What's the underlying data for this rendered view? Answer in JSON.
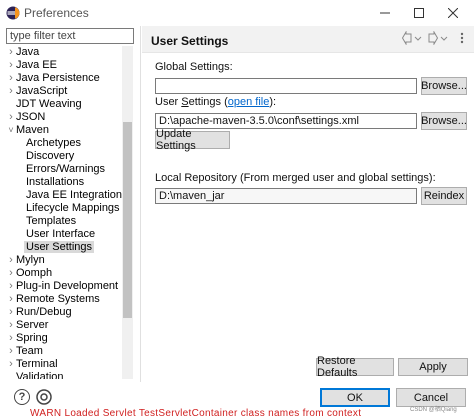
{
  "window": {
    "title": "Preferences"
  },
  "filter": {
    "placeholder": "type filter text"
  },
  "tree": {
    "items": [
      {
        "label": "Java",
        "expandable": true,
        "level": 0
      },
      {
        "label": "Java EE",
        "expandable": true,
        "level": 0
      },
      {
        "label": "Java Persistence",
        "expandable": true,
        "level": 0
      },
      {
        "label": "JavaScript",
        "expandable": true,
        "level": 0
      },
      {
        "label": "JDT Weaving",
        "expandable": false,
        "level": 0
      },
      {
        "label": "JSON",
        "expandable": true,
        "level": 0
      },
      {
        "label": "Maven",
        "expandable": true,
        "expanded": true,
        "level": 0
      },
      {
        "label": "Archetypes",
        "expandable": false,
        "level": 1
      },
      {
        "label": "Discovery",
        "expandable": false,
        "level": 1
      },
      {
        "label": "Errors/Warnings",
        "expandable": false,
        "level": 1
      },
      {
        "label": "Installations",
        "expandable": false,
        "level": 1
      },
      {
        "label": "Java EE Integration",
        "expandable": false,
        "level": 1
      },
      {
        "label": "Lifecycle Mappings",
        "expandable": false,
        "level": 1
      },
      {
        "label": "Templates",
        "expandable": false,
        "level": 1
      },
      {
        "label": "User Interface",
        "expandable": false,
        "level": 1
      },
      {
        "label": "User Settings",
        "expandable": false,
        "level": 1,
        "selected": true
      },
      {
        "label": "Mylyn",
        "expandable": true,
        "level": 0
      },
      {
        "label": "Oomph",
        "expandable": true,
        "level": 0
      },
      {
        "label": "Plug-in Development",
        "expandable": true,
        "level": 0
      },
      {
        "label": "Remote Systems",
        "expandable": true,
        "level": 0
      },
      {
        "label": "Run/Debug",
        "expandable": true,
        "level": 0
      },
      {
        "label": "Server",
        "expandable": true,
        "level": 0
      },
      {
        "label": "Spring",
        "expandable": true,
        "level": 0
      },
      {
        "label": "Team",
        "expandable": true,
        "level": 0
      },
      {
        "label": "Terminal",
        "expandable": true,
        "level": 0
      },
      {
        "label": "Validation",
        "expandable": false,
        "level": 0
      }
    ]
  },
  "page": {
    "title": "User Settings",
    "global_settings_label": "Global Settings:",
    "global_settings_value": "",
    "browse_label": "Browse...",
    "user_settings_prefix": "User ",
    "user_settings_mnemonic": "S",
    "user_settings_rest": "ettings (",
    "open_file_link": "open file",
    "user_settings_suffix": "):",
    "user_settings_value": "D:\\apache-maven-3.5.0\\conf\\settings.xml",
    "update_settings_label": "Update Settings",
    "local_repo_label": "Local Repository (From merged user and global settings):",
    "local_repo_value": "D:\\maven_jar",
    "reindex_label": "Reindex",
    "restore_defaults_label": "Restore Defaults",
    "apply_label": "Apply"
  },
  "footer": {
    "ok_label": "OK",
    "cancel_label": "Cancel",
    "watermark": "CSDN @栖Qiang",
    "background_text": "WARN  Loaded Servlet  TestServletContainer class names from context"
  },
  "colors": {
    "link": "#0066cc",
    "selection": "#d9d9d9",
    "ok_border": "#0078d7",
    "background_text": "#d02020"
  }
}
